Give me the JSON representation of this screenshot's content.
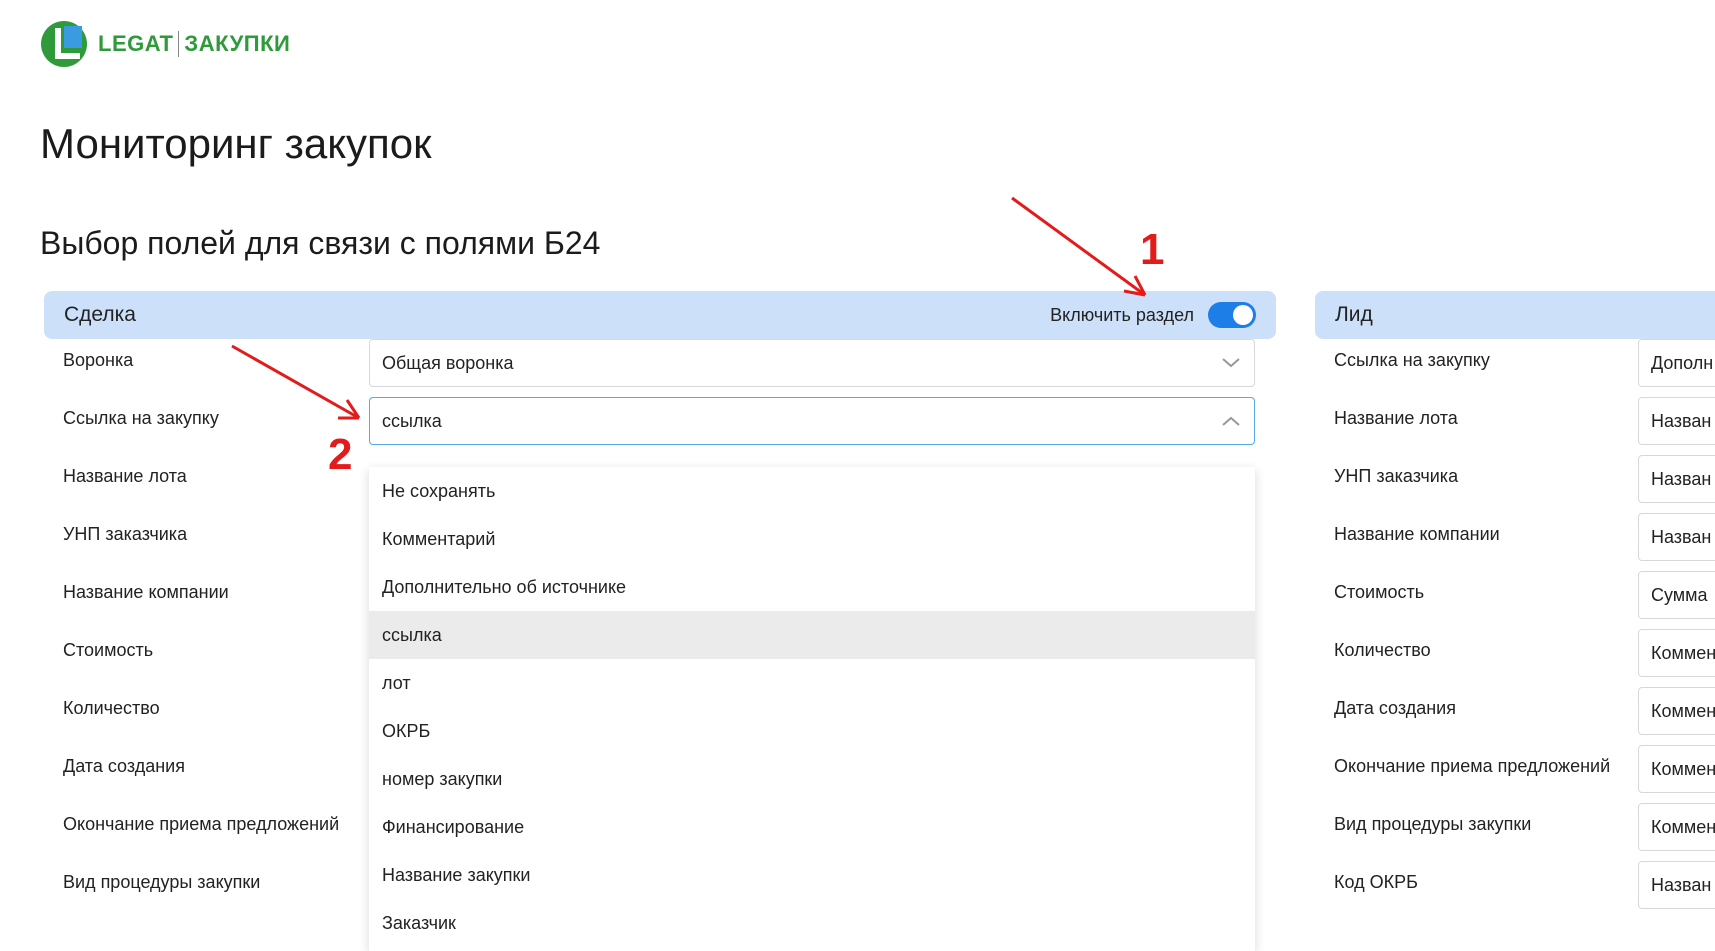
{
  "logo": {
    "brand": "LEGAT",
    "product": "ЗАКУПКИ"
  },
  "page_title": "Мониторинг закупок",
  "section_title": "Выбор полей для связи с полями Б24",
  "deal": {
    "title": "Сделка",
    "toggle_label": "Включить раздел",
    "toggle_on": true,
    "rows": [
      {
        "label": "Воронка",
        "value": "Общая воронка"
      },
      {
        "label": "Ссылка на закупку",
        "value": "ссылка"
      },
      {
        "label": "Название лота"
      },
      {
        "label": "УНП заказчика"
      },
      {
        "label": "Название компании"
      },
      {
        "label": "Стоимость"
      },
      {
        "label": "Количество"
      },
      {
        "label": "Дата создания"
      },
      {
        "label": "Окончание приема предложений"
      },
      {
        "label": "Вид процедуры закупки"
      }
    ],
    "dropdown_options": [
      "Не сохранять",
      "Комментарий",
      "Дополнительно об источнике",
      "ссылка",
      "лот",
      "ОКРБ",
      "номер закупки",
      "Финансирование",
      "Название закупки",
      "Заказчик"
    ],
    "dropdown_selected": "ссылка"
  },
  "lead": {
    "title": "Лид",
    "rows": [
      {
        "label": "Ссылка на закупку",
        "value": "Дополн"
      },
      {
        "label": "Название лота",
        "value": "Назван"
      },
      {
        "label": "УНП заказчика",
        "value": "Назван"
      },
      {
        "label": "Название компании",
        "value": "Назван"
      },
      {
        "label": "Стоимость",
        "value": "Сумма"
      },
      {
        "label": "Количество",
        "value": "Коммен"
      },
      {
        "label": "Дата создания",
        "value": "Коммен"
      },
      {
        "label": "Окончание приема предложений",
        "value": "Коммен"
      },
      {
        "label": "Вид процедуры закупки",
        "value": "Коммен"
      },
      {
        "label": "Код ОКРБ",
        "value": "Назван"
      }
    ]
  },
  "annotations": [
    "1",
    "2"
  ],
  "colors": {
    "accent": "#1e7ee8",
    "header_bg": "#cce0fa",
    "brand_green": "#2e9a3a",
    "annotation": "#e31b1b"
  },
  "icons": {
    "select_closed": "chevron-down-icon",
    "select_open": "chevron-up-icon"
  }
}
